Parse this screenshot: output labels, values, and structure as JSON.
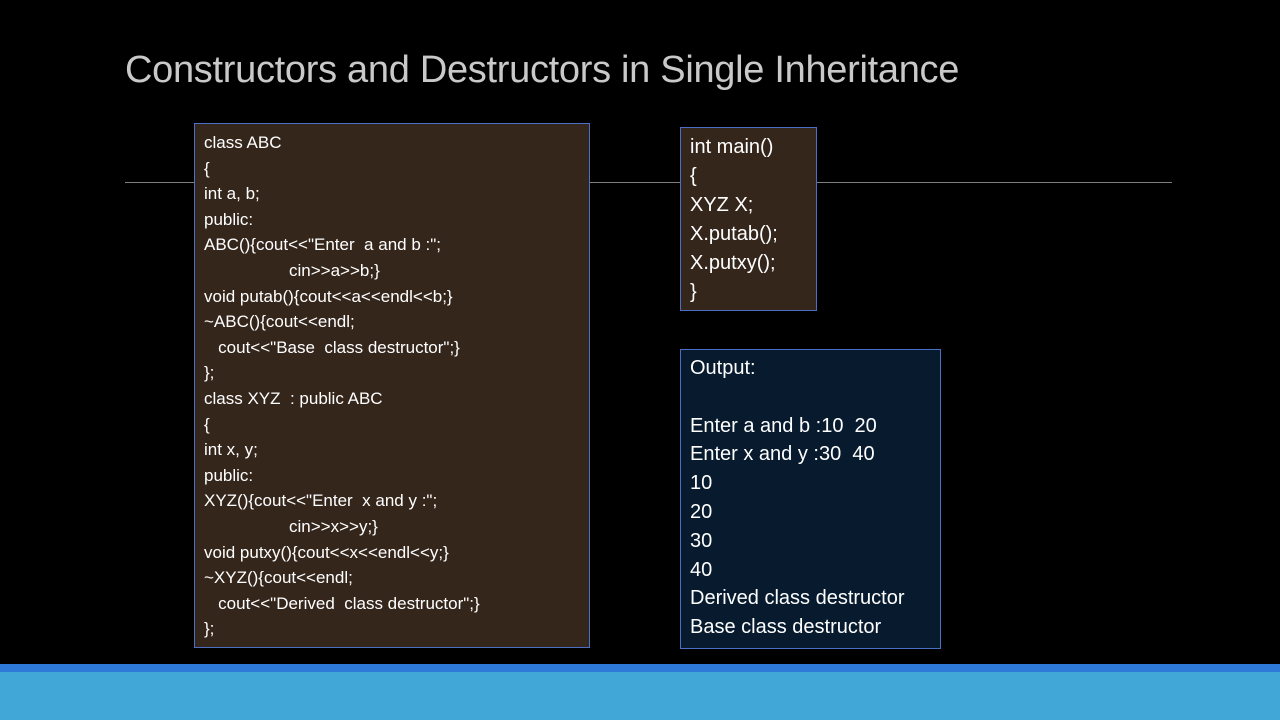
{
  "slide": {
    "title": "Constructors and Destructors in Single Inheritance"
  },
  "code_box": {
    "lines": [
      "class ABC",
      "{",
      "int a, b;",
      "public:",
      "ABC(){cout<<\"Enter  a and b :\";",
      "                  cin>>a>>b;}",
      "void putab(){cout<<a<<endl<<b;}",
      "~ABC(){cout<<endl;",
      "   cout<<\"Base  class destructor\";}",
      "};",
      "class XYZ  : public ABC",
      "{",
      "int x, y;",
      "public:",
      "XYZ(){cout<<\"Enter  x and y :\";",
      "                  cin>>x>>y;}",
      "void putxy(){cout<<x<<endl<<y;}",
      "~XYZ(){cout<<endl;",
      "   cout<<\"Derived  class destructor\";}",
      "};"
    ]
  },
  "main_box": {
    "lines": [
      "int main()",
      "{",
      "XYZ X;",
      "X.putab();",
      "X.putxy();",
      "}"
    ]
  },
  "output_box": {
    "lines": [
      "Output:",
      "",
      "Enter a and b :10  20",
      "Enter x and y :30  40",
      "10",
      "20",
      "30",
      "40",
      "Derived class destructor",
      "Base class destructor"
    ]
  },
  "colors": {
    "background": "#000000",
    "title": "#c9c9c9",
    "code_box_fill": "#35261c",
    "output_box_fill": "#071a2e",
    "box_border": "#4a6fc3",
    "band_dark": "#2d7ad8",
    "band_light": "#41a7d6"
  }
}
